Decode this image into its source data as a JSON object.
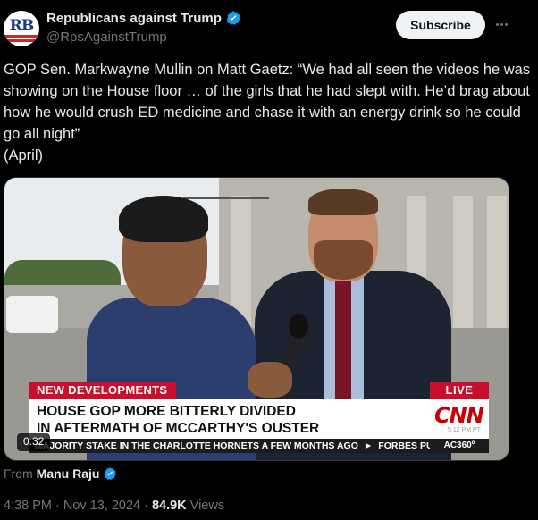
{
  "author": {
    "display_name": "Republicans against Trump",
    "handle": "@RpsAgainstTrump",
    "avatar_text": "RB",
    "verified": true
  },
  "actions": {
    "subscribe_label": "Subscribe",
    "more_icon": "more-horizontal-icon"
  },
  "tweet_text": "GOP Sen. Markwayne Mullin on Matt Gaetz: “We had all seen the videos he was showing on the House floor … of the girls that he had slept with. He’d brag about how he would crush ED medicine and chase it with an energy drink so he could go all night”\n(April)",
  "media": {
    "duration": "0:32",
    "chyron_label": "NEW DEVELOPMENTS",
    "live_label": "LIVE",
    "headline_line1": "HOUSE GOP MORE BITTERLY DIVIDED",
    "headline_line2": "IN AFTERMATH OF MCCARTHY'S OUSTER",
    "network_logo": "CNN",
    "network_time": "5:12 PM PT",
    "ticker_text1": "MAJORITY STAKE IN THE CHARLOTTE HORNETS A FEW MONTHS AGO",
    "ticker_text2": "FORBES PUTS",
    "show_tag": "AC360º"
  },
  "attribution": {
    "prefix": "From",
    "source_name": "Manu Raju",
    "verified": true
  },
  "meta": {
    "time": "4:38 PM",
    "separator": "·",
    "date": "Nov 13, 2024",
    "views_count": "84.9K",
    "views_label": "Views"
  },
  "colors": {
    "background": "#000000",
    "text_primary": "#e7e9ea",
    "text_secondary": "#71767b",
    "verified_blue": "#1d9bf0",
    "cnn_red": "#c8102e"
  }
}
